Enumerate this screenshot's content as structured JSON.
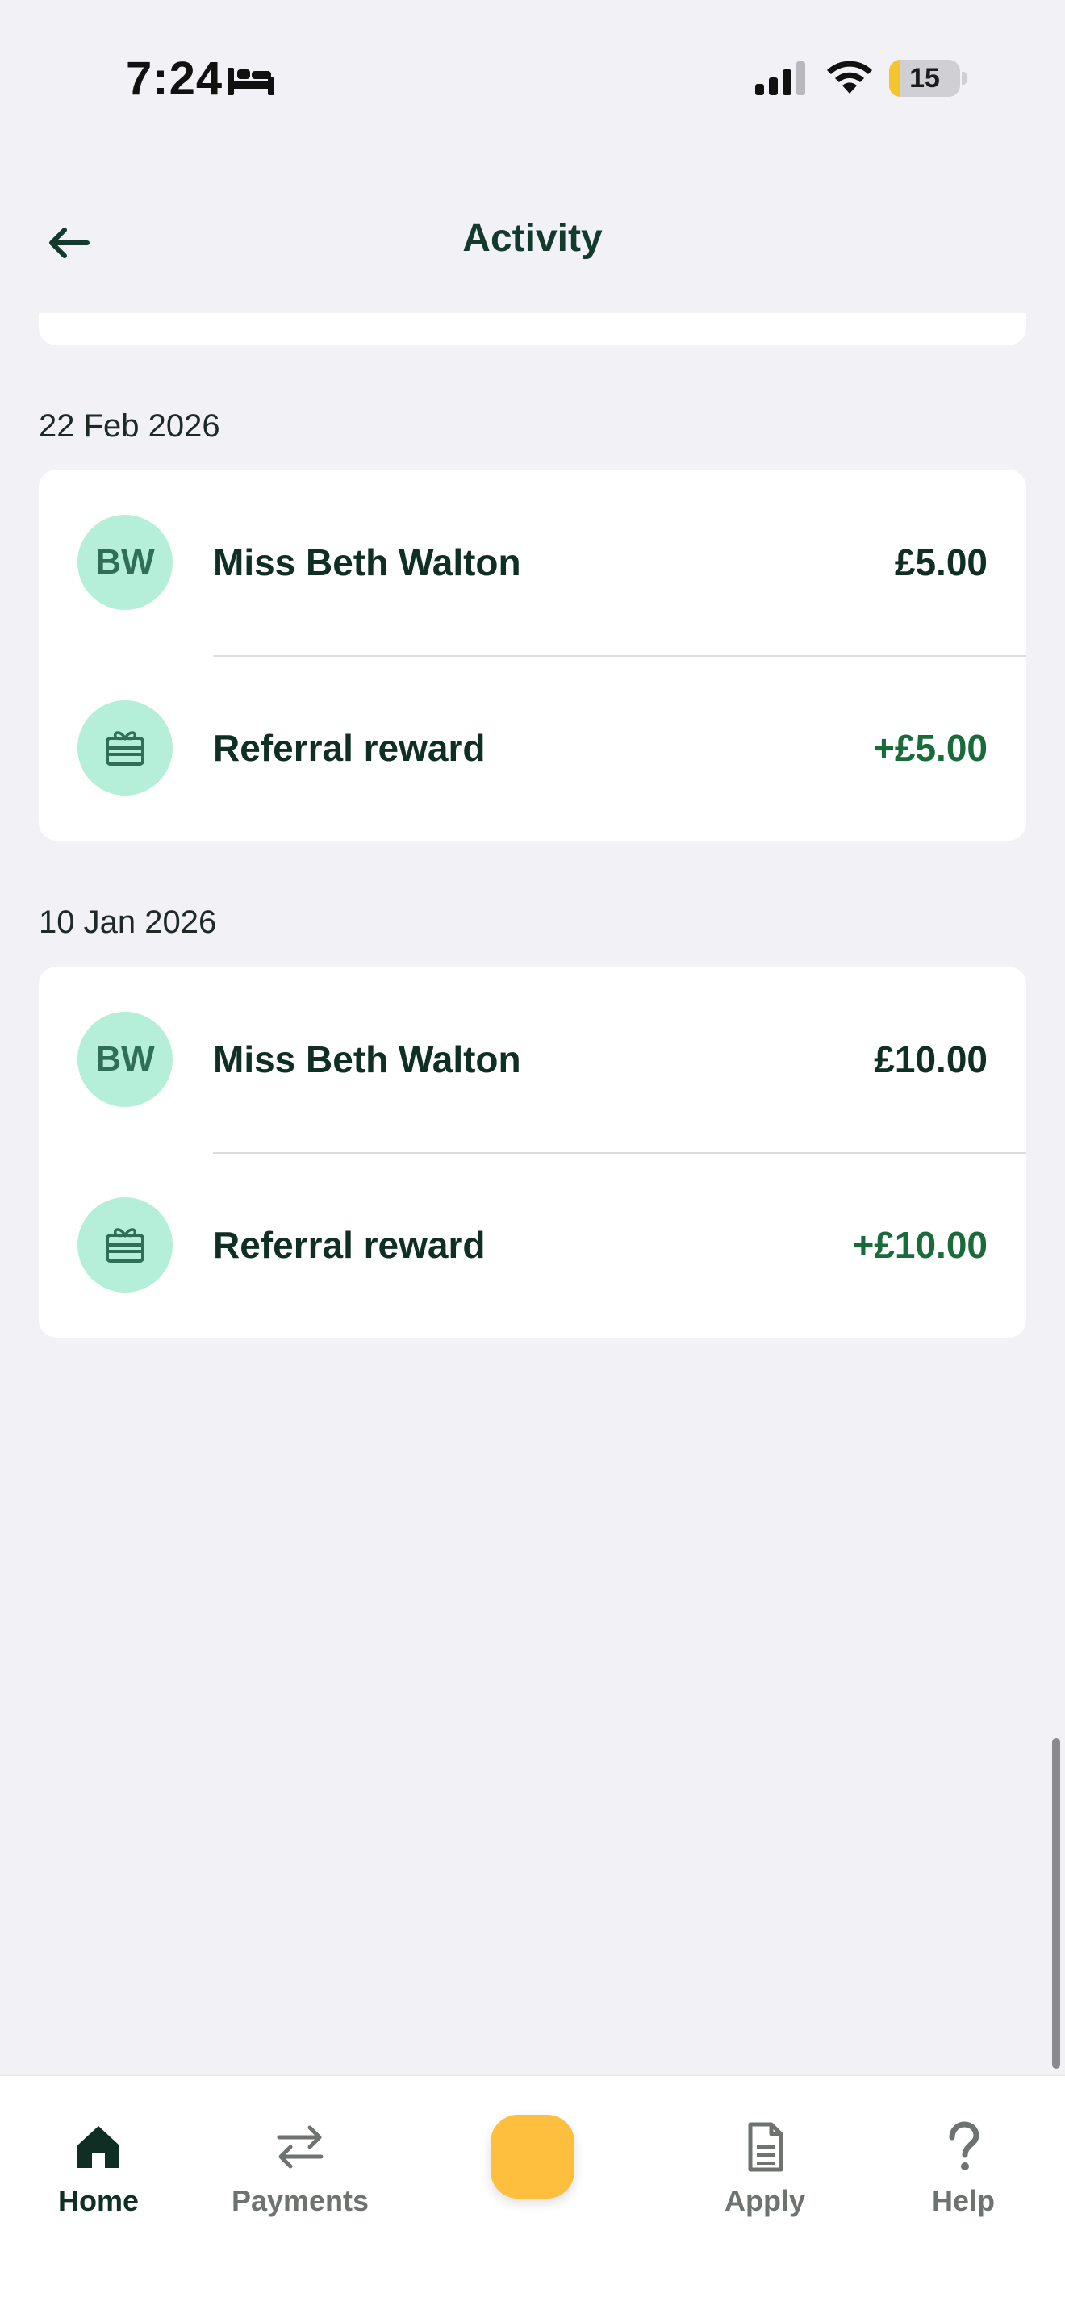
{
  "status_bar": {
    "time": "7:24",
    "battery": "15",
    "battery_level": 0.15
  },
  "header": {
    "title": "Activity"
  },
  "groups": [
    {
      "date": "22 Feb 2026",
      "items": [
        {
          "type": "person",
          "initials": "BW",
          "title": "Miss Beth Walton",
          "amount": "£5.00"
        },
        {
          "type": "reward",
          "icon": "gift-card-icon",
          "title": "Referral reward",
          "amount": "+£5.00"
        }
      ]
    },
    {
      "date": "10 Jan 2026",
      "items": [
        {
          "type": "person",
          "initials": "BW",
          "title": "Miss Beth Walton",
          "amount": "£10.00"
        },
        {
          "type": "reward",
          "icon": "gift-card-icon",
          "title": "Referral reward",
          "amount": "+£10.00"
        }
      ]
    }
  ],
  "nav": {
    "home": "Home",
    "payments": "Payments",
    "apply": "Apply",
    "help": "Help"
  },
  "colors": {
    "accent": "#fdbf3d",
    "credit": "#1a6b3a",
    "avatar_bg": "#b6efd9",
    "text": "#0f2e24"
  }
}
